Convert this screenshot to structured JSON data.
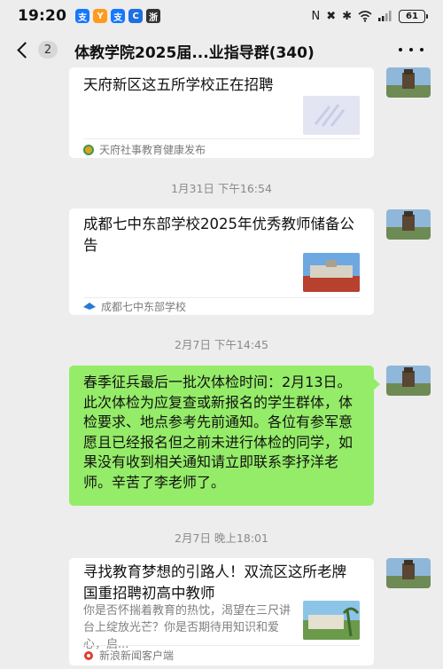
{
  "status_bar": {
    "time": "19:20",
    "notif_icons": [
      "支",
      "Y",
      "支",
      "C",
      "浙"
    ],
    "battery": "61"
  },
  "header": {
    "unread_count": "2",
    "title": "体教学院2025届...业指导群(340)"
  },
  "messages": [
    {
      "type": "card",
      "title": "天府新区这五所学校正在招聘",
      "source": "天府社事教育健康发布"
    },
    {
      "type": "timestamp",
      "text": "1月31日 下午16:54"
    },
    {
      "type": "card",
      "title": "成都七中东部学校2025年优秀教师储备公告",
      "source": "成都七中东部学校"
    },
    {
      "type": "timestamp",
      "text": "2月7日 下午14:45"
    },
    {
      "type": "text",
      "text": "春季征兵最后一批次体检时间：2月13日。此次体检为应复查或新报名的学生群体，体检要求、地点参考先前通知。各位有参军意愿且已经报名但之前未进行体检的同学，如果没有收到相关通知请立即联系李抒洋老师。辛苦了李老师了。"
    },
    {
      "type": "timestamp",
      "text": "2月7日 晚上18:01"
    },
    {
      "type": "card",
      "title": "寻找教育梦想的引路人！双流区这所老牌国重招聘初高中教师",
      "desc": "你是否怀揣着教育的热忱，渴望在三尺讲台上绽放光芒？你是否期待用知识和爱心，启...",
      "source": "新浪新闻客户端"
    }
  ]
}
